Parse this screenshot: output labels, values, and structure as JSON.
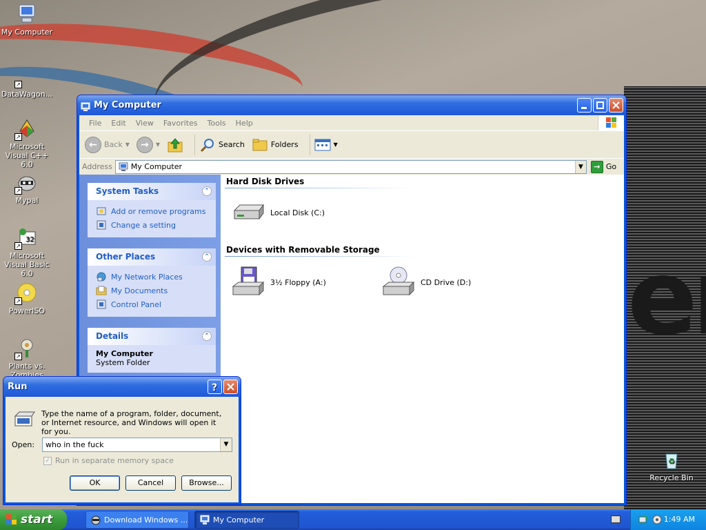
{
  "desktop": {
    "icons": [
      {
        "label": "My Computer",
        "icon": "my-computer-icon"
      },
      {
        "label": "DataWagon...",
        "icon": "shortcut-icon"
      },
      {
        "label": "Microsoft Visual C++ 6.0",
        "icon": "visual-cpp-icon"
      },
      {
        "label": "Mypal",
        "icon": "mypal-icon"
      },
      {
        "label": "Microsoft Visual Basic 6.0",
        "icon": "visual-basic-icon"
      },
      {
        "label": "PowerISO",
        "icon": "poweriso-icon"
      },
      {
        "label": "Plants vs. Zombies",
        "icon": "pvz-icon"
      },
      {
        "label": "Recycle Bin",
        "icon": "recycle-bin-icon"
      }
    ]
  },
  "explorer": {
    "title": "My Computer",
    "menu": [
      "File",
      "Edit",
      "View",
      "Favorites",
      "Tools",
      "Help"
    ],
    "toolbar": {
      "back": "Back",
      "search": "Search",
      "folders": "Folders"
    },
    "address": {
      "label": "Address",
      "value": "My Computer",
      "go": "Go"
    },
    "left": {
      "system_tasks": {
        "title": "System Tasks",
        "items": [
          "Add or remove programs",
          "Change a setting"
        ]
      },
      "other_places": {
        "title": "Other Places",
        "items": [
          "My Network Places",
          "My Documents",
          "Control Panel"
        ]
      },
      "details": {
        "title": "Details",
        "name": "My Computer",
        "type": "System Folder"
      }
    },
    "groups": {
      "hard_disk": {
        "title": "Hard Disk Drives",
        "items": [
          "Local Disk (C:)"
        ]
      },
      "removable": {
        "title": "Devices with Removable Storage",
        "items": [
          "3½ Floppy (A:)",
          "CD Drive (D:)"
        ]
      }
    }
  },
  "run": {
    "title": "Run",
    "description": "Type the name of a program, folder, document, or Internet resource, and Windows will open it for you.",
    "open_label": "Open:",
    "open_value": "who in the fuck",
    "checkbox": "Run in separate memory space",
    "ok": "OK",
    "cancel": "Cancel",
    "browse": "Browse..."
  },
  "taskbar": {
    "start": "start",
    "tasks": [
      "Download Windows ...",
      "My Computer"
    ],
    "clock": "1:49 AM"
  },
  "colors": {
    "xp_blue": "#0855dd",
    "task_pane_link": "#215dc6",
    "start_green": "#3c9e3c"
  }
}
